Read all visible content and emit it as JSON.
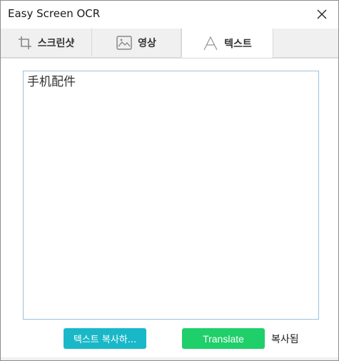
{
  "window": {
    "title": "Easy Screen OCR"
  },
  "tabs": [
    {
      "label": "스크린샷",
      "icon": "crop-icon",
      "active": false
    },
    {
      "label": "영상",
      "icon": "image-icon",
      "active": false
    },
    {
      "label": "텍스트",
      "icon": "text-a-icon",
      "active": true
    }
  ],
  "main": {
    "ocr_text": "手机配件"
  },
  "actions": {
    "copy_label": "텍스트 복사하...",
    "translate_label": "Translate",
    "status": "복사됨"
  },
  "colors": {
    "copy_button": "#19b8c8",
    "translate_button": "#1ecf6a",
    "textarea_border": "#9bc1dc"
  }
}
